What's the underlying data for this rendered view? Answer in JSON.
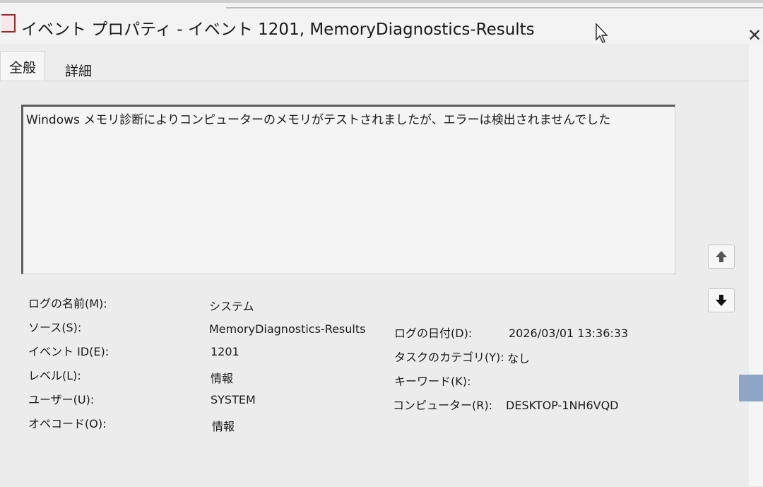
{
  "window": {
    "title": "イベント プロパティ - イベント 1201, MemoryDiagnostics-Results",
    "close_glyph": "✕"
  },
  "tabs": [
    {
      "label": "全般"
    },
    {
      "label": "詳細"
    }
  ],
  "description": "Windows メモリ診断によりコンピューターのメモリがテストされましたが、エラーは検出されませんでした",
  "fields": {
    "log_name": {
      "label": "ログの名前(M):",
      "value": "システム"
    },
    "source": {
      "label": "ソース(S):",
      "value": "MemoryDiagnostics-Results"
    },
    "event_id": {
      "label": "イベント ID(E):",
      "value": "1201"
    },
    "level": {
      "label": "レベル(L):",
      "value": "情報"
    },
    "user": {
      "label": "ユーザー(U):",
      "value": "SYSTEM"
    },
    "opcode": {
      "label": "オペコード(O):",
      "value": "情報"
    },
    "logged": {
      "label": "ログの日付(D):",
      "value": "2026/03/01 13:36:33"
    },
    "task_category": {
      "label": "タスクのカテゴリ(Y):",
      "value": "なし"
    },
    "keywords": {
      "label": "キーワード(K):",
      "value": ""
    },
    "computer": {
      "label": "コンピューター(R):",
      "value": "DESKTOP-1NH6VQD"
    }
  },
  "icons": {
    "scroll_up": "arrow-up-icon",
    "scroll_down": "arrow-down-icon"
  }
}
